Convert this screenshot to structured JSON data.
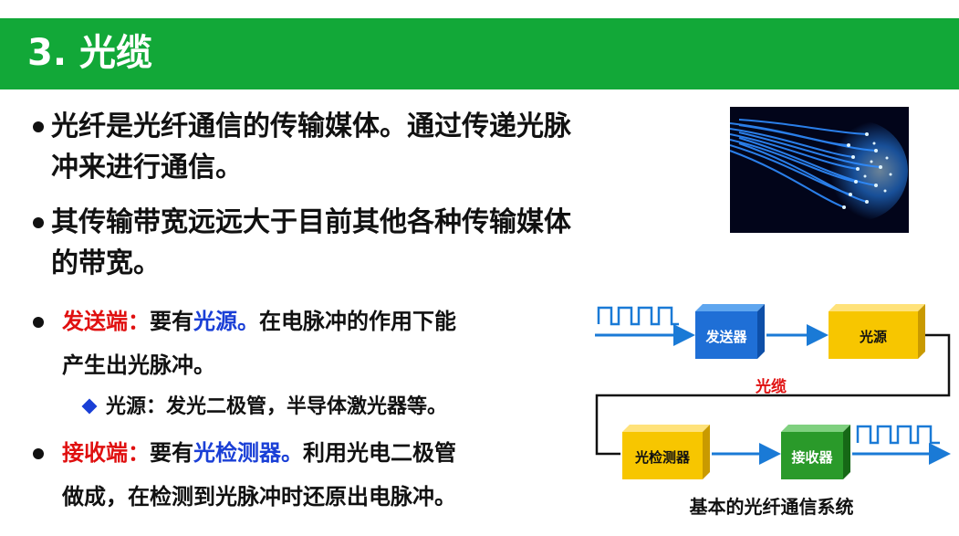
{
  "title": "3. 光缆",
  "bullets": [
    {
      "line1": "光纤是光纤通信的传输媒体。通过传递光脉",
      "line2": "冲来进行通信。"
    },
    {
      "line1": "其传输带宽远远大于目前其他各种传输媒体",
      "line2": "的带宽。"
    }
  ],
  "sender": {
    "label": "发送端：",
    "pre": "要有",
    "highlight": "光源。",
    "rest": "在电脉冲的作用下能",
    "line2": "产生出光脉冲。"
  },
  "sub_bullet": "光源：发光二极管，半导体激光器等。",
  "receiver": {
    "label": "接收端：",
    "pre": "要有",
    "highlight": "光检测器。",
    "rest": "利用光电二极管",
    "line2": "做成，在检测到光脉冲时还原出电脉冲。"
  },
  "diagram": {
    "sender_box": "发送器",
    "source_box": "光源",
    "cable_label": "光缆",
    "detector_box": "光检测器",
    "receiver_box": "接收器",
    "caption": "基本的光纤通信系统",
    "colors": {
      "blue_box": "#1f6fd6",
      "yellow_box": "#f7c600",
      "green_box": "#2a9a2a",
      "arrow": "#1a7ad6",
      "cable_label": "#e01010"
    }
  },
  "photo": {
    "icon": "fiber-optic-photo"
  },
  "colors": {
    "title_bar": "#12a838",
    "accent_red": "#e01010",
    "accent_blue": "#1a3fd6"
  }
}
